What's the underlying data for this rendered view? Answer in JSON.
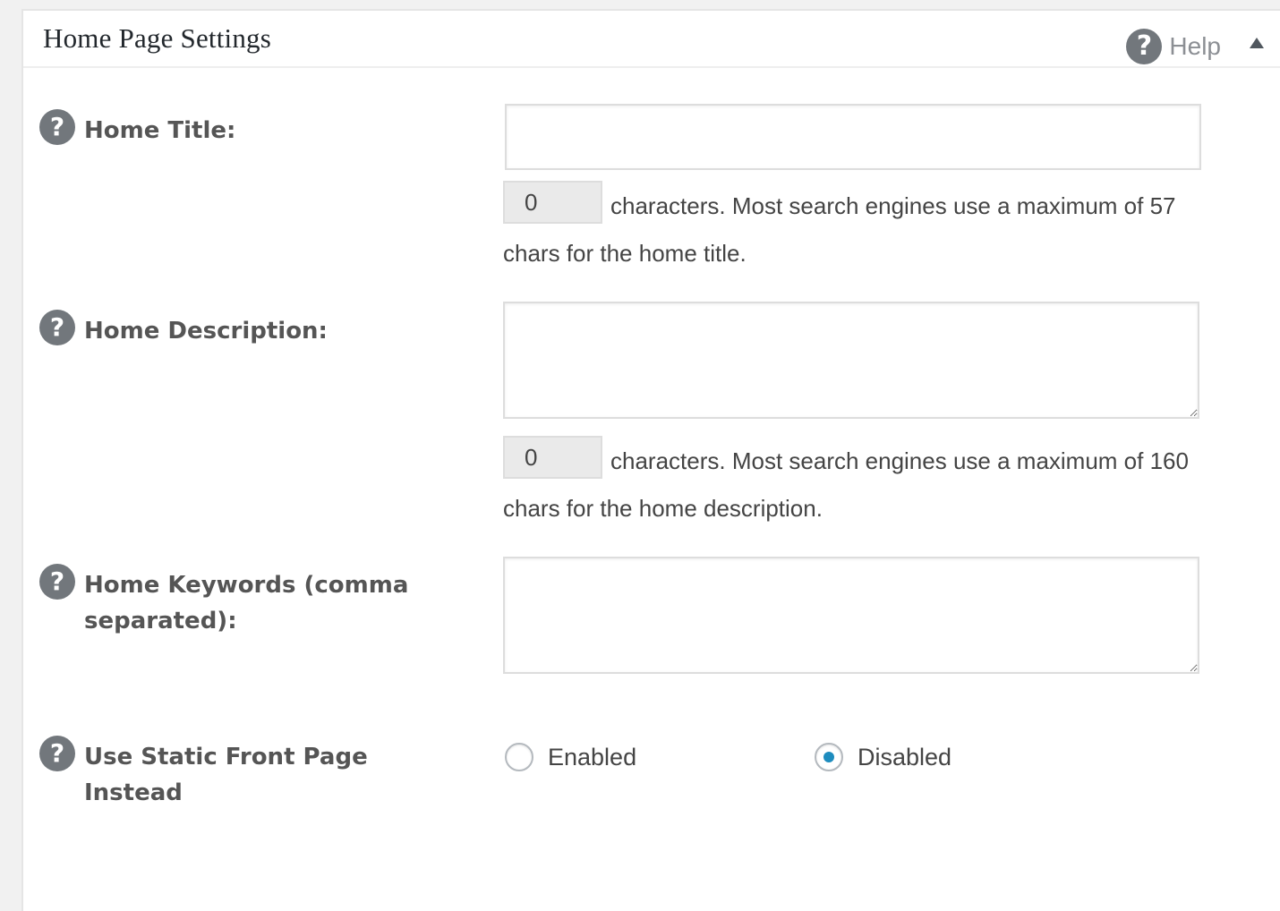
{
  "panel": {
    "title": "Home Page Settings",
    "help_label": "Help",
    "help_icon": "question-circle-icon",
    "collapse_icon": "triangle-up-icon"
  },
  "fields": {
    "home_title": {
      "label": "Home Title:",
      "value": "",
      "count": "0",
      "hint_line1": "characters. Most search engines use a maximum of 57",
      "hint_line2": "chars for the home title."
    },
    "home_description": {
      "label": "Home Description:",
      "value": "",
      "count": "0",
      "hint_line1": "characters. Most search engines use a maximum of 160",
      "hint_line2": "chars for the home description."
    },
    "home_keywords": {
      "label_line1": "Home Keywords (comma",
      "label_line2": "separated):",
      "value": ""
    },
    "static_front_page": {
      "label_line1": "Use Static Front Page",
      "label_line2": "Instead",
      "options": [
        "Enabled",
        "Disabled"
      ],
      "selected": "Disabled"
    }
  },
  "colors": {
    "radio_accent": "#1e8cbe",
    "help_icon_bg": "#72777c",
    "label_text": "#555555"
  }
}
